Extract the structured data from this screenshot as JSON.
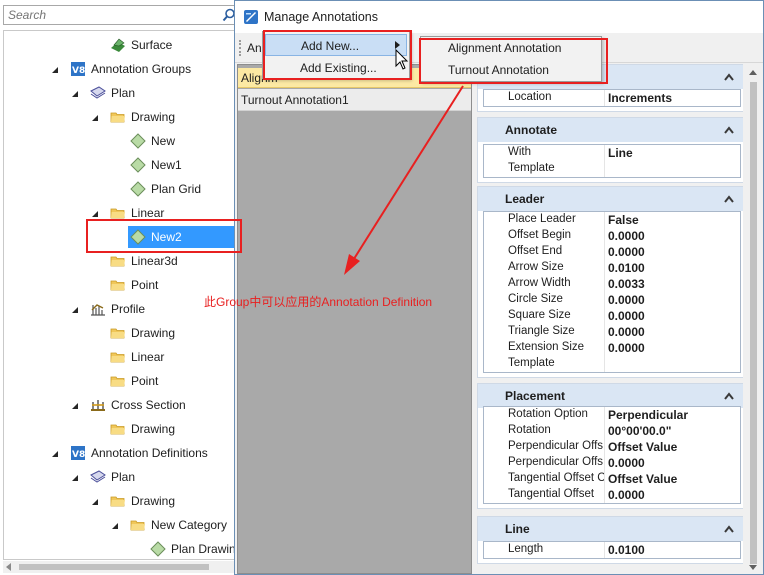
{
  "colors": {
    "selection": "#3399ff",
    "highlight_yellow": "#fce9a3",
    "section_header": "#dae6f4",
    "annotation_red": "#e82020",
    "list_pane_gray": "#a9a9a9"
  },
  "explorer": {
    "search_placeholder": "Search",
    "tree": [
      {
        "label": "Surface",
        "icon": "surface-icon"
      },
      {
        "label": "Annotation Groups",
        "icon": "v8-icon"
      },
      {
        "label": "Plan",
        "icon": "plan-view-icon"
      },
      {
        "label": "Drawing",
        "icon": "folder-icon"
      },
      {
        "label": "New",
        "icon": "annotation-diamond-icon"
      },
      {
        "label": "New1",
        "icon": "annotation-diamond-icon"
      },
      {
        "label": "Plan Grid",
        "icon": "annotation-diamond-icon"
      },
      {
        "label": "Linear",
        "icon": "folder-icon"
      },
      {
        "label": "New2",
        "icon": "annotation-diamond-icon"
      },
      {
        "label": "Linear3d",
        "icon": "folder-icon"
      },
      {
        "label": "Point",
        "icon": "folder-icon"
      },
      {
        "label": "Profile",
        "icon": "profile-icon"
      },
      {
        "label": "Drawing",
        "icon": "folder-icon"
      },
      {
        "label": "Linear",
        "icon": "folder-icon"
      },
      {
        "label": "Point",
        "icon": "folder-icon"
      },
      {
        "label": "Cross Section",
        "icon": "cross-section-icon"
      },
      {
        "label": "Drawing",
        "icon": "folder-icon"
      },
      {
        "label": "Annotation Definitions",
        "icon": "v8-icon"
      },
      {
        "label": "Plan",
        "icon": "plan-view-icon"
      },
      {
        "label": "Drawing",
        "icon": "folder-icon"
      },
      {
        "label": "New Category",
        "icon": "folder-icon"
      },
      {
        "label": "Plan Drawing",
        "icon": "annotation-diamond-icon"
      }
    ]
  },
  "dialog": {
    "title": "Manage Annotations",
    "toolbar_button": "An",
    "list_header": "Alignm",
    "list_items": [
      "Turnout Annotation1"
    ],
    "sections": [
      {
        "title": "",
        "rows": [
          {
            "key": "Location",
            "value": "Increments"
          }
        ]
      },
      {
        "title": "Annotate",
        "rows": [
          {
            "key": "With",
            "value": "Line"
          },
          {
            "key": "Template",
            "value": ""
          }
        ]
      },
      {
        "title": "Leader",
        "rows": [
          {
            "key": "Place Leader",
            "value": "False"
          },
          {
            "key": "Offset Begin",
            "value": "0.0000"
          },
          {
            "key": "Offset End",
            "value": "0.0000"
          },
          {
            "key": "Arrow Size",
            "value": "0.0100"
          },
          {
            "key": "Arrow Width",
            "value": "0.0033"
          },
          {
            "key": "Circle Size",
            "value": "0.0000"
          },
          {
            "key": "Square Size",
            "value": "0.0000"
          },
          {
            "key": "Triangle Size",
            "value": "0.0000"
          },
          {
            "key": "Extension Size",
            "value": "0.0000"
          },
          {
            "key": "Template",
            "value": ""
          }
        ]
      },
      {
        "title": "Placement",
        "rows": [
          {
            "key": "Rotation Option",
            "value": "Perpendicular"
          },
          {
            "key": "Rotation",
            "value": "00°00'00.0\""
          },
          {
            "key": "Perpendicular Offs",
            "value": "Offset Value"
          },
          {
            "key": "Perpendicular Offs",
            "value": "0.0000"
          },
          {
            "key": "Tangential Offset C",
            "value": "Offset Value"
          },
          {
            "key": "Tangential Offset",
            "value": "0.0000"
          }
        ]
      },
      {
        "title": "Line",
        "rows": [
          {
            "key": "Length",
            "value": "0.0100"
          }
        ]
      }
    ]
  },
  "menu": {
    "add_new": "Add New...",
    "add_existing": "Add Existing..."
  },
  "submenu": {
    "alignment": "Alignment Annotation",
    "turnout": "Turnout Annotation"
  },
  "annotation_note": "此Group中可以应用的Annotation Definition"
}
